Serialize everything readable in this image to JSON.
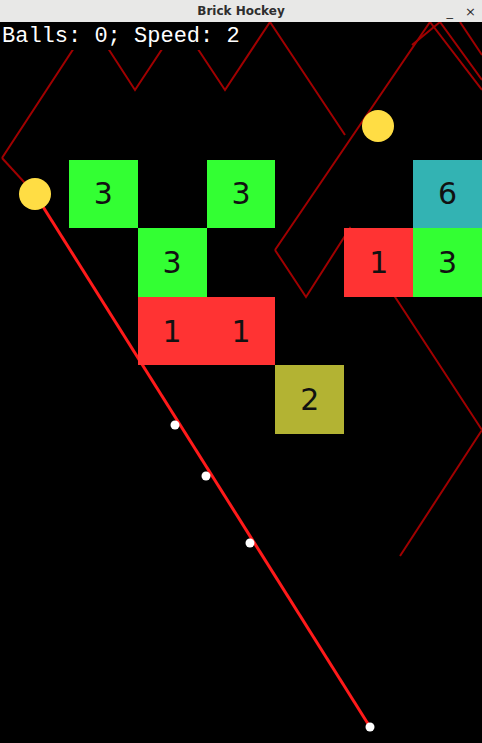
{
  "window": {
    "title": "Brick Hockey",
    "buttons": [
      "_",
      "×"
    ]
  },
  "hud": {
    "text": "Balls: 0; Speed: 2"
  },
  "bricks": [
    [
      null,
      null,
      null,
      null,
      null,
      null,
      null
    ],
    [
      null,
      {
        "value": "3",
        "color": "#33ff33"
      },
      null,
      {
        "value": "3",
        "color": "#33ff33"
      },
      null,
      null,
      {
        "value": "6",
        "color": "#33b3b3"
      }
    ],
    [
      null,
      null,
      {
        "value": "3",
        "color": "#33ff33"
      },
      null,
      null,
      {
        "value": "1",
        "color": "#ff3333"
      },
      {
        "value": "3",
        "color": "#33ff33"
      }
    ],
    [
      null,
      null,
      {
        "value": "1",
        "color": "#ff3333"
      },
      {
        "value": "1",
        "color": "#ff3333"
      },
      null,
      null,
      null
    ],
    [
      null,
      null,
      null,
      null,
      {
        "value": "2",
        "color": "#b3b333"
      },
      null,
      null
    ]
  ]
}
